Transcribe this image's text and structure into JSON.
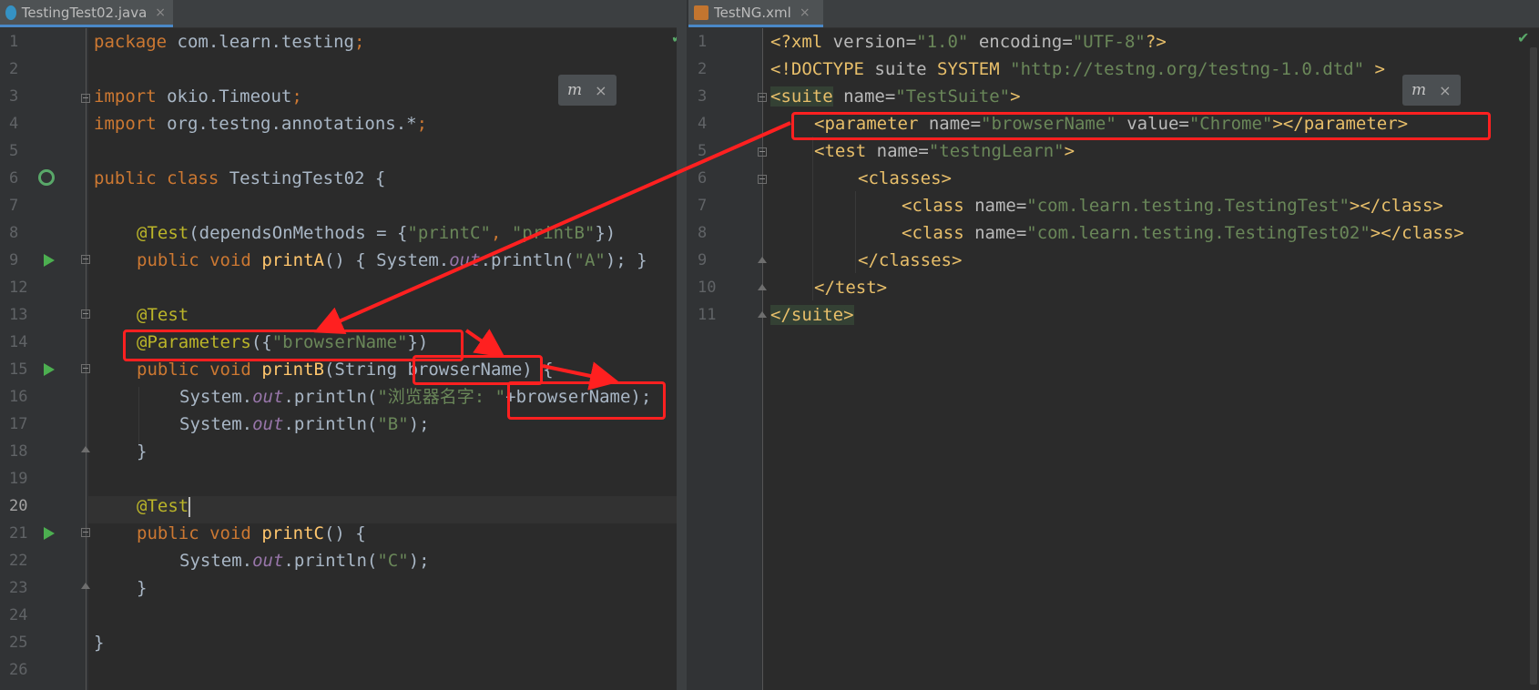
{
  "left_tab": {
    "label": "TestingTest02.java",
    "close": "×",
    "icon": "java-class-icon"
  },
  "right_tab": {
    "label": "TestNG.xml",
    "close": "×",
    "icon": "xml-file-icon"
  },
  "left_line_numbers": [
    "1",
    "2",
    "3",
    "4",
    "5",
    "6",
    "7",
    "8",
    "9",
    "12",
    "13",
    "14",
    "15",
    "16",
    "17",
    "18",
    "19",
    "20",
    "21",
    "22",
    "23",
    "24",
    "25",
    "26"
  ],
  "right_line_numbers": [
    "1",
    "2",
    "3",
    "4",
    "5",
    "6",
    "7",
    "8",
    "9",
    "10",
    "11"
  ],
  "java": {
    "l1": {
      "k": "package",
      "t": " com.learn.testing",
      "s": ";"
    },
    "l3": {
      "k": "import",
      "t": " okio.Timeout",
      "s": ";"
    },
    "l4": {
      "k": "import",
      "t": " org.testng.annotations.*",
      "s": ";"
    },
    "l6": {
      "k1": "public",
      "k2": "class",
      "t": " TestingTest02 {"
    },
    "l8": {
      "a": "@Test",
      "t1": "(dependsOnMethods = {",
      "s1": "\"printC\"",
      "c": ", ",
      "s2": "\"printB\"",
      "t2": "})"
    },
    "l9": {
      "k1": "public",
      "k2": "void",
      "f": "printA",
      "t1": "() { System.",
      "o": "out",
      "t2": ".println(",
      "s": "\"A\"",
      "t3": "); }"
    },
    "l13": {
      "a": "@Test"
    },
    "l14": {
      "a": "@Parameters",
      "t1": "({",
      "s": "\"browserName\"",
      "t2": "})"
    },
    "l15": {
      "k1": "public",
      "k2": "void",
      "f": "printB",
      "t1": "(String browserName) {"
    },
    "l16": {
      "t1": "System.",
      "o": "out",
      "t2": ".println(",
      "s": "\"浏览器名字: \"",
      "t3": "+browserName);"
    },
    "l17": {
      "t1": "System.",
      "o": "out",
      "t2": ".println(",
      "s": "\"B\"",
      "t3": ");"
    },
    "l18": {
      "t": "}"
    },
    "l20": {
      "a": "@Test"
    },
    "l21": {
      "k1": "public",
      "k2": "void",
      "f": "printC",
      "t1": "() {"
    },
    "l22": {
      "t1": "System.",
      "o": "out",
      "t2": ".println(",
      "s": "\"C\"",
      "t3": ");"
    },
    "l23": {
      "t": "}"
    },
    "l25": {
      "t": "}"
    }
  },
  "xml": {
    "x1": {
      "p1": "<?xml ",
      "a1": "version",
      "eq1": "=",
      "v1": "\"1.0\"",
      "sp": " ",
      "a2": "encoding",
      "eq2": "=",
      "v2": "\"UTF-8\"",
      "p2": "?>"
    },
    "x2": {
      "p1": "<!DOCTYPE ",
      "t1": "suite ",
      "k": "SYSTEM",
      "sp": " ",
      "v": "\"http://testng.org/testng-1.0.dtd\"",
      "p2": " >"
    },
    "x3": {
      "tg": "<suite",
      "a": " name",
      "eq": "=",
      "v": "\"TestSuite\"",
      "e": ">"
    },
    "x4": {
      "tg": "<parameter",
      "a1": " name",
      "eq1": "=",
      "v1": "\"browserName\"",
      "a2": " value",
      "eq2": "=",
      "v2": "\"Chrome\"",
      "e": "></parameter>"
    },
    "x5": {
      "tg": "<test",
      "a": " name",
      "eq": "=",
      "v": "\"testngLearn\"",
      "e": ">"
    },
    "x6": {
      "tg": "<classes>"
    },
    "x7": {
      "tg": "<class",
      "a": " name",
      "eq": "=",
      "v": "\"com.learn.testing.TestingTest\"",
      "e": "></class>"
    },
    "x8": {
      "tg": "<class",
      "a": " name",
      "eq": "=",
      "v": "\"com.learn.testing.TestingTest02\"",
      "e": "></class>"
    },
    "x9": {
      "tg": "</classes>"
    },
    "x10": {
      "tg": "</test>"
    },
    "x11": {
      "tg": "</suite>"
    }
  },
  "popup_left": {
    "icon": "m",
    "close": "×"
  },
  "popup_right": {
    "icon": "m",
    "close": "×"
  },
  "colors": {
    "annotation_red": "#ff2020",
    "keyword": "#cc7832",
    "string": "#6a8759",
    "annotation": "#bbb529",
    "method": "#ffc66d",
    "tag": "#e8bf6a"
  }
}
